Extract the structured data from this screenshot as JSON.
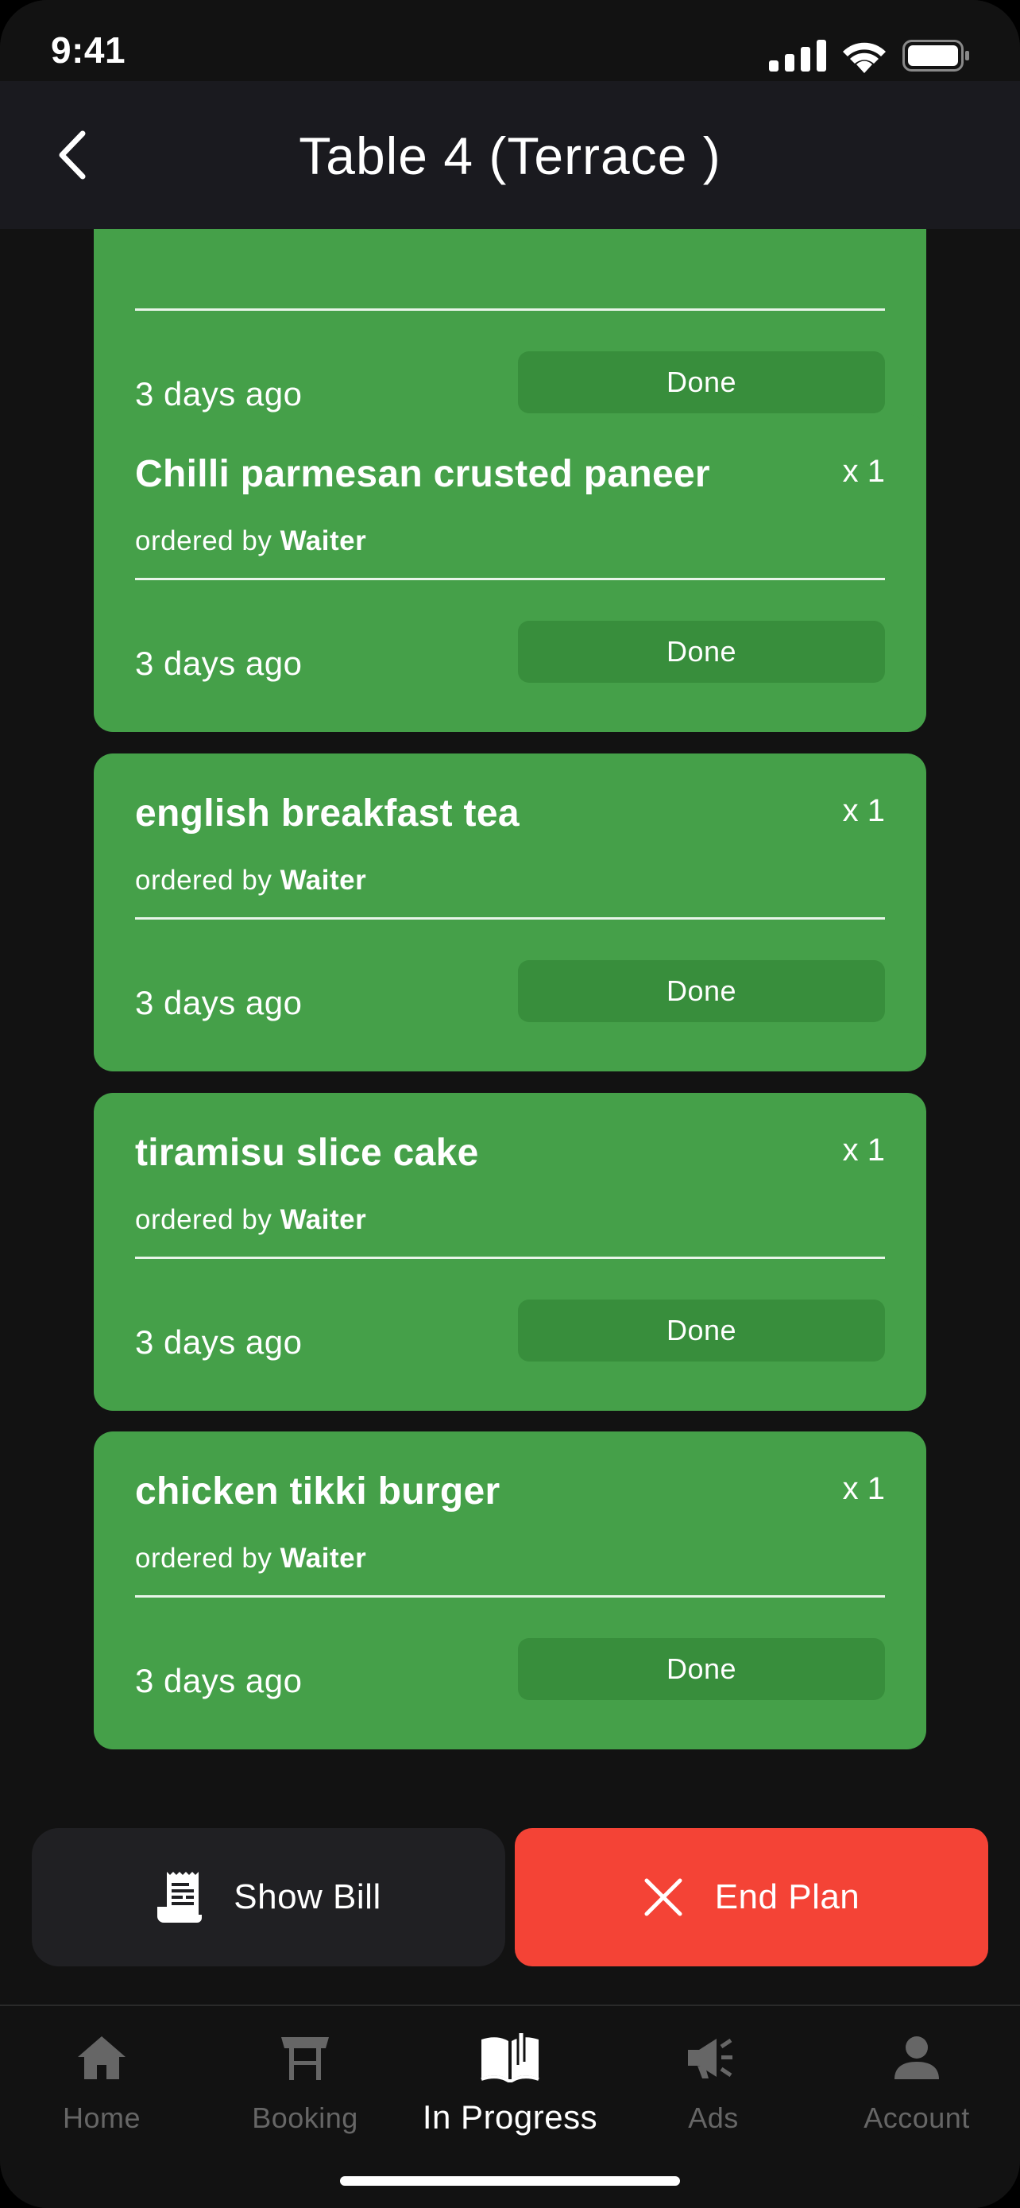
{
  "status_bar": {
    "time": "9:41"
  },
  "header": {
    "title": "Table 4  (Terrace )"
  },
  "orders": [
    {
      "name": "",
      "quantity": "",
      "ordered_by_prefix": "",
      "ordered_by": "",
      "time": "3 days ago",
      "status_label": "Done"
    },
    {
      "name": "Chilli parmesan crusted paneer",
      "quantity": "x 1",
      "ordered_by_prefix": "ordered by",
      "ordered_by": "Waiter",
      "time": "3 days ago",
      "status_label": "Done"
    },
    {
      "name": "english breakfast tea",
      "quantity": "x 1",
      "ordered_by_prefix": "ordered by",
      "ordered_by": "Waiter",
      "time": "3 days ago",
      "status_label": "Done"
    },
    {
      "name": "tiramisu slice cake",
      "quantity": "x 1",
      "ordered_by_prefix": "ordered by",
      "ordered_by": "Waiter",
      "time": "3 days ago",
      "status_label": "Done"
    },
    {
      "name": "chicken tikki burger",
      "quantity": "x 1",
      "ordered_by_prefix": "ordered by",
      "ordered_by": "Waiter",
      "time": "3 days ago",
      "status_label": "Done"
    }
  ],
  "actions": {
    "show_bill": "Show Bill",
    "end_plan": "End Plan"
  },
  "tabs": [
    {
      "label": "Home",
      "icon": "home-icon",
      "active": false
    },
    {
      "label": "Booking",
      "icon": "table-icon",
      "active": false
    },
    {
      "label": "In Progress",
      "icon": "book-icon",
      "active": true
    },
    {
      "label": "Ads",
      "icon": "megaphone-icon",
      "active": false
    },
    {
      "label": "Account",
      "icon": "user-icon",
      "active": false
    }
  ],
  "colors": {
    "card_green": "#45a049",
    "done_button": "#388e3c",
    "end_plan_red": "#f44336",
    "background": "#121212",
    "header": "#1a1a1f"
  }
}
